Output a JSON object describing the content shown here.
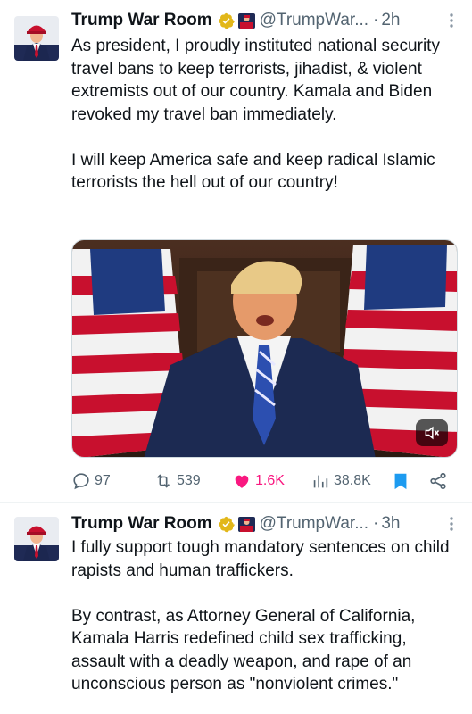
{
  "tweets": [
    {
      "author_name": "Trump War Room",
      "handle": "@TrumpWar...",
      "separator": "·",
      "time": "2h",
      "text": "As president, I proudly instituted national security travel bans to keep terrorists, jihadist, & violent extremists out of our country. Kamala and Biden revoked my travel ban immediately.\n\nI will keep America safe and keep radical Islamic terrorists the hell out of our country!",
      "media": {
        "type": "video",
        "muted": true
      },
      "stats": {
        "replies": "97",
        "retweets": "539",
        "likes": "1.6K",
        "views": "38.8K"
      },
      "liked": true,
      "bookmarked": true
    },
    {
      "author_name": "Trump War Room",
      "handle": "@TrumpWar...",
      "separator": "·",
      "time": "3h",
      "text": "I fully support tough mandatory sentences on child rapists and human traffickers.\n\nBy contrast, as Attorney General of California, Kamala Harris redefined child sex trafficking, assault with a deadly weapon, and rape of an unconscious person as \"nonviolent crimes.\""
    }
  ],
  "colors": {
    "text": "#0f1419",
    "secondary": "#536471",
    "like_pink": "#f91880",
    "bookmark_blue": "#1d9bf0",
    "verified_gold": "#e2b719"
  },
  "icons": [
    "reply-icon",
    "retweet-icon",
    "heart-icon",
    "views-icon",
    "bookmark-icon",
    "share-icon",
    "more-icon",
    "verified-badge-icon",
    "mute-icon"
  ]
}
